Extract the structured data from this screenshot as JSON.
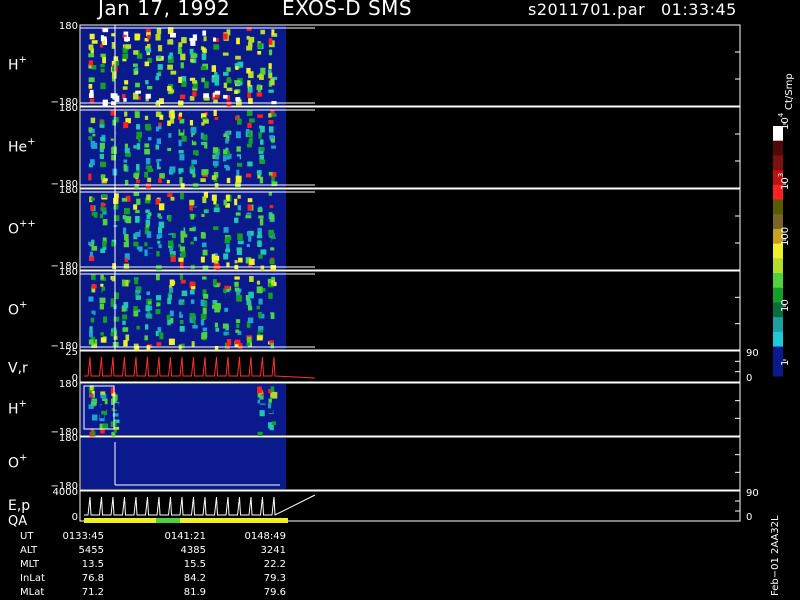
{
  "header": {
    "date": "Jan 17, 1992",
    "instrument": "EXOS-D SMS",
    "file": "s2011701.par",
    "time": "01:33:45"
  },
  "colorbar": {
    "unit": "Ct/Smp",
    "ticks": [
      "1",
      "10",
      "100",
      "10",
      "10"
    ],
    "tick_exponents": [
      "",
      "",
      "",
      "3",
      "4"
    ],
    "colors": [
      "#0a1a8c",
      "#0a1a8c",
      "#1ec8d8",
      "#1ea0a0",
      "#0a6e3c",
      "#14a028",
      "#50d23c",
      "#b4dc28",
      "#f0f028",
      "#c8a01e",
      "#786428",
      "#5a5a00",
      "#ff2020",
      "#c01010",
      "#801010",
      "#500808",
      "#ffffff"
    ]
  },
  "panels": [
    {
      "id": "H",
      "label": "H",
      "sup": "+",
      "ymax": "180",
      "ymin": "−180"
    },
    {
      "id": "He",
      "label": "He",
      "sup": "+",
      "ymax": "180",
      "ymin": "−180"
    },
    {
      "id": "O2",
      "label": "O",
      "sup": "++",
      "ymax": "180",
      "ymin": "−180"
    },
    {
      "id": "O",
      "label": "O",
      "sup": "+",
      "ymax": "180",
      "ymin": "−180"
    },
    {
      "id": "Vr",
      "label": "V,r",
      "sup": "",
      "ymax": "25",
      "ymin": "0",
      "rmax": "90",
      "rmin": "0"
    },
    {
      "id": "H2",
      "label": "H",
      "sup": "+",
      "ymax": "180",
      "ymin": "−180"
    },
    {
      "id": "O3",
      "label": "O",
      "sup": "+",
      "ymax": "180",
      "ymin": "−180"
    },
    {
      "id": "Ep",
      "label": "E,p",
      "sup": "",
      "label2": "QA",
      "ymax": "4000",
      "ymin": "0",
      "rmax": "90",
      "rmin": "0"
    }
  ],
  "footer": {
    "rows": [
      {
        "label": "UT",
        "values": [
          "0133:45",
          "0141:21",
          "0148:49"
        ]
      },
      {
        "label": "ALT",
        "values": [
          "5455",
          "4385",
          "3241"
        ]
      },
      {
        "label": "MLT",
        "values": [
          "13.5",
          "15.5",
          "22.2"
        ]
      },
      {
        "label": "InLat",
        "values": [
          "76.8",
          "84.2",
          "79.3"
        ]
      },
      {
        "label": "MLat",
        "values": [
          "71.2",
          "81.9",
          "79.6"
        ]
      }
    ]
  },
  "side_label": "Feb−01 2AA32L",
  "chart_data": {
    "type": "heatmap",
    "title": "Jan 17, 1992   EXOS-D SMS",
    "x_ticks": [
      "0133:45",
      "0141:21",
      "0148:49"
    ],
    "panels": [
      {
        "name": "H+",
        "ylim": [
          -180,
          180
        ],
        "data_extent": "first ~30% of time axis"
      },
      {
        "name": "He+",
        "ylim": [
          -180,
          180
        ]
      },
      {
        "name": "O++",
        "ylim": [
          -180,
          180
        ]
      },
      {
        "name": "O+",
        "ylim": [
          -180,
          180
        ]
      },
      {
        "name": "V,r",
        "ylim": [
          0,
          25
        ],
        "right_ylim": [
          0,
          90
        ]
      },
      {
        "name": "H+",
        "ylim": [
          -180,
          180
        ]
      },
      {
        "name": "O+",
        "ylim": [
          -180,
          180
        ]
      },
      {
        "name": "E,p QA",
        "ylim": [
          0,
          4000
        ],
        "right_ylim": [
          0,
          90
        ]
      }
    ],
    "colorbar": {
      "unit": "Ct/Smp",
      "scale": "log",
      "range": [
        1,
        10000
      ]
    }
  }
}
